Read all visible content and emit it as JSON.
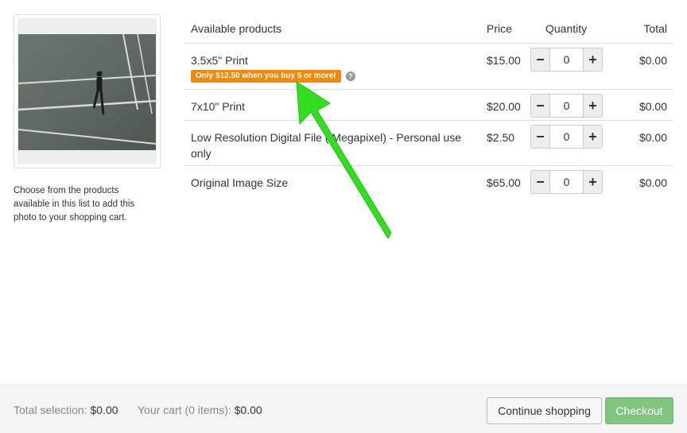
{
  "photo": {
    "caption": "Choose from the products available in this list to add this photo to your shopping cart."
  },
  "table": {
    "headers": {
      "name": "Available products",
      "price": "Price",
      "quantity": "Quantity",
      "total": "Total"
    },
    "rows": [
      {
        "name": "3.5x5\" Print",
        "price": "$15.00",
        "quantity": "0",
        "total": "$0.00",
        "promo": "Only $12.50 when you buy 5 or more!",
        "help_icon": "?"
      },
      {
        "name": "7x10\" Print",
        "price": "$20.00",
        "quantity": "0",
        "total": "$0.00"
      },
      {
        "name": "Low Resolution Digital File (  Megapixel) - Personal use only",
        "price": "$2.50",
        "quantity": "0",
        "total": "$0.00"
      },
      {
        "name": "Original Image Size",
        "price": "$65.00",
        "quantity": "0",
        "total": "$0.00"
      }
    ],
    "minus_glyph": "−",
    "plus_glyph": "+"
  },
  "footer": {
    "selection_label": "Total selection:",
    "selection_value": "$0.00",
    "cart_label": "Your cart (0 items):",
    "cart_value": "$0.00",
    "continue_label": "Continue shopping",
    "checkout_label": "Checkout"
  },
  "colors": {
    "promo_badge": "#f0890c",
    "checkout_button": "#80c480",
    "annotation_arrow": "#33dd22"
  },
  "icons": {
    "help": "question-circle-icon",
    "minus": "minus-icon",
    "plus": "plus-icon",
    "annotation": "green-arrow-annotation"
  }
}
